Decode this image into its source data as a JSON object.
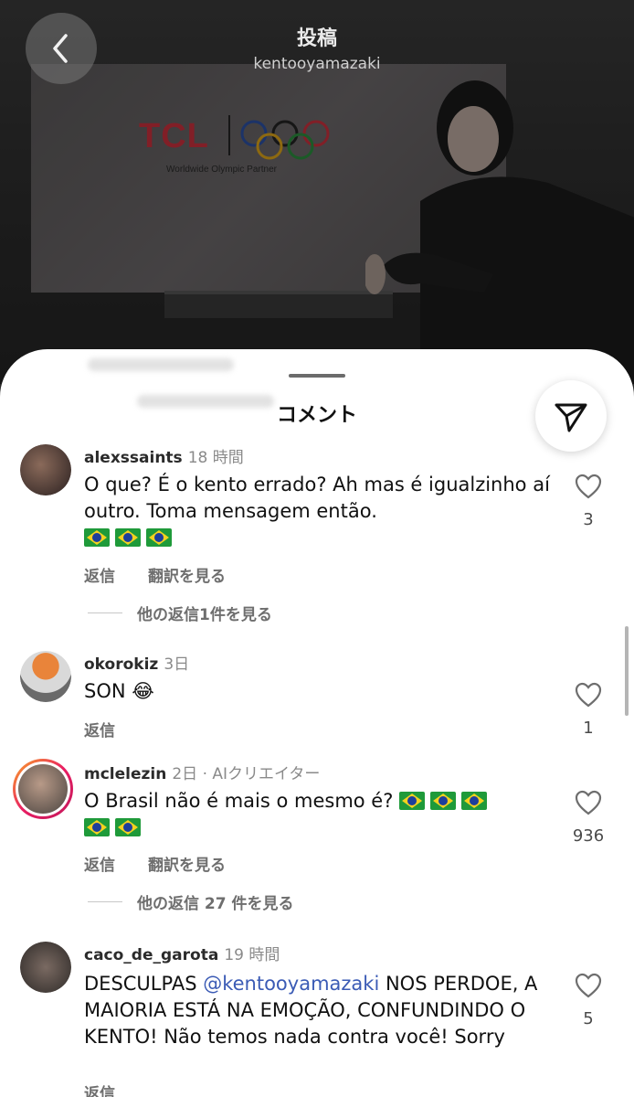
{
  "header": {
    "title": "投稿",
    "subtitle": "kentooyamazaki"
  },
  "post_image": {
    "tv_brand": "TCL",
    "tv_partner_text": "Worldwide Olympic Partner"
  },
  "sheet": {
    "title": "コメント"
  },
  "comments": [
    {
      "user": "alexssaints",
      "time": "18 時間",
      "text": "O que? É o kento errado? Ah mas é igualzinho aí outro. Toma mensagem então.",
      "flags": 3,
      "like_count": "3",
      "reply_label": "返信",
      "translate_label": "翻訳を見る",
      "more_replies": "他の返信1件を見る"
    },
    {
      "user": "okorokiz",
      "time": "3日",
      "text": "SON 😂",
      "like_count": "1",
      "reply_label": "返信"
    },
    {
      "user": "mclelezin",
      "time": "2日 · AIクリエイター",
      "text": "O Brasil não é mais o mesmo é?",
      "flags": 5,
      "like_count": "936",
      "reply_label": "返信",
      "translate_label": "翻訳を見る",
      "more_replies": "他の返信 27 件を見る"
    },
    {
      "user": "caco_de_garota",
      "time": "19 時間",
      "text_before": "DESCULPAS ",
      "mention": "@kentooyamazaki",
      "text_after": " NOS PERDOE, A MAIORIA ESTÁ NA EMOÇÃO, CONFUNDINDO O KENTO! Não temos nada contra você! Sorry",
      "like_count": "5",
      "reply_label": "返信"
    }
  ],
  "icons": {
    "back": "chevron-left-icon",
    "share": "paper-plane-icon",
    "like": "heart-outline-icon"
  },
  "colors": {
    "sheet_bg": "#ffffff",
    "mention": "#3b5bb5",
    "secondary_text": "#6e6e6e",
    "tcl_red": "#c7303d"
  }
}
